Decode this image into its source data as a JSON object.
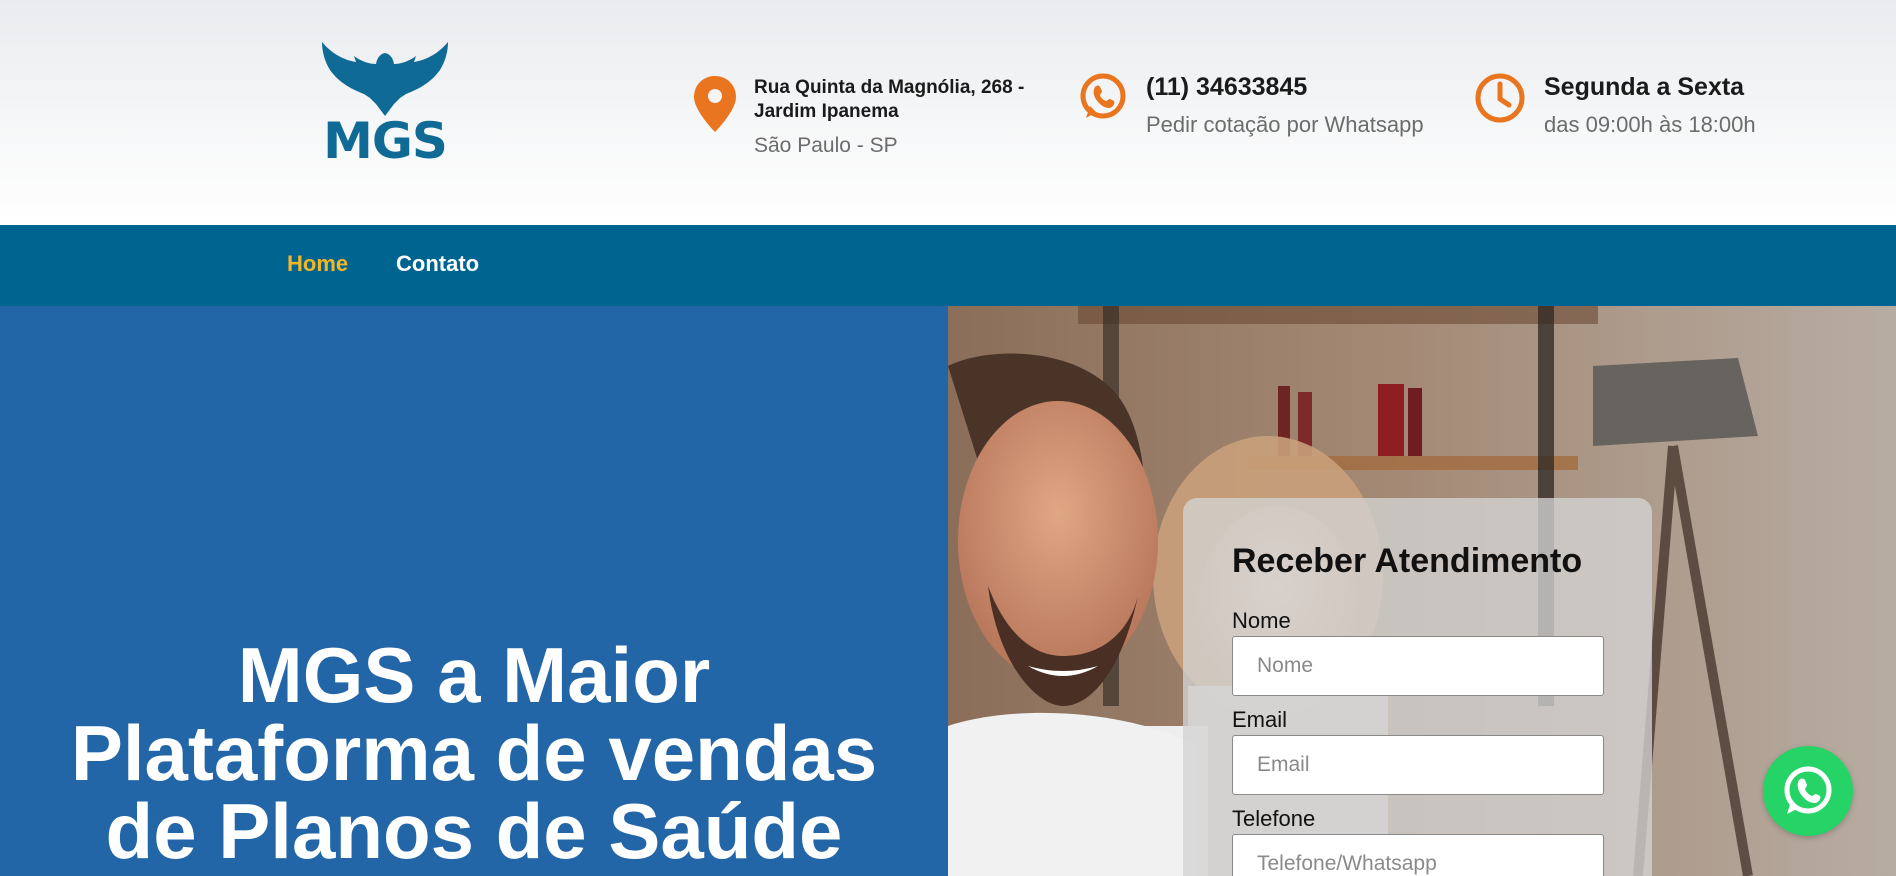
{
  "brand": {
    "logo_text": "MGS",
    "primary_color": "#006491",
    "accent_color": "#f4b526",
    "icon_color": "#e9761e"
  },
  "header": {
    "address": {
      "icon": "map-pin-icon",
      "line1": "Rua Quinta da Magnólia, 268 - Jardim Ipanema",
      "line2": "São Paulo - SP"
    },
    "phone": {
      "icon": "whatsapp-icon",
      "number": "(11) 34633845",
      "subtitle": "Pedir cotação por Whatsapp"
    },
    "hours": {
      "icon": "clock-icon",
      "days": "Segunda a Sexta",
      "time": "das 09:00h às 18:00h"
    }
  },
  "nav": {
    "items": [
      {
        "label": "Home",
        "active": true
      },
      {
        "label": "Contato",
        "active": false
      }
    ]
  },
  "hero": {
    "title": "MGS a Maior Plataforma de vendas de Planos de Saúde"
  },
  "form": {
    "title": "Receber Atendimento",
    "fields": [
      {
        "label": "Nome",
        "placeholder": "Nome"
      },
      {
        "label": "Email",
        "placeholder": "Email"
      },
      {
        "label": "Telefone",
        "placeholder": "Telefone/Whatsapp"
      }
    ]
  },
  "floating": {
    "icon": "whatsapp-float-icon",
    "color": "#25d366"
  }
}
